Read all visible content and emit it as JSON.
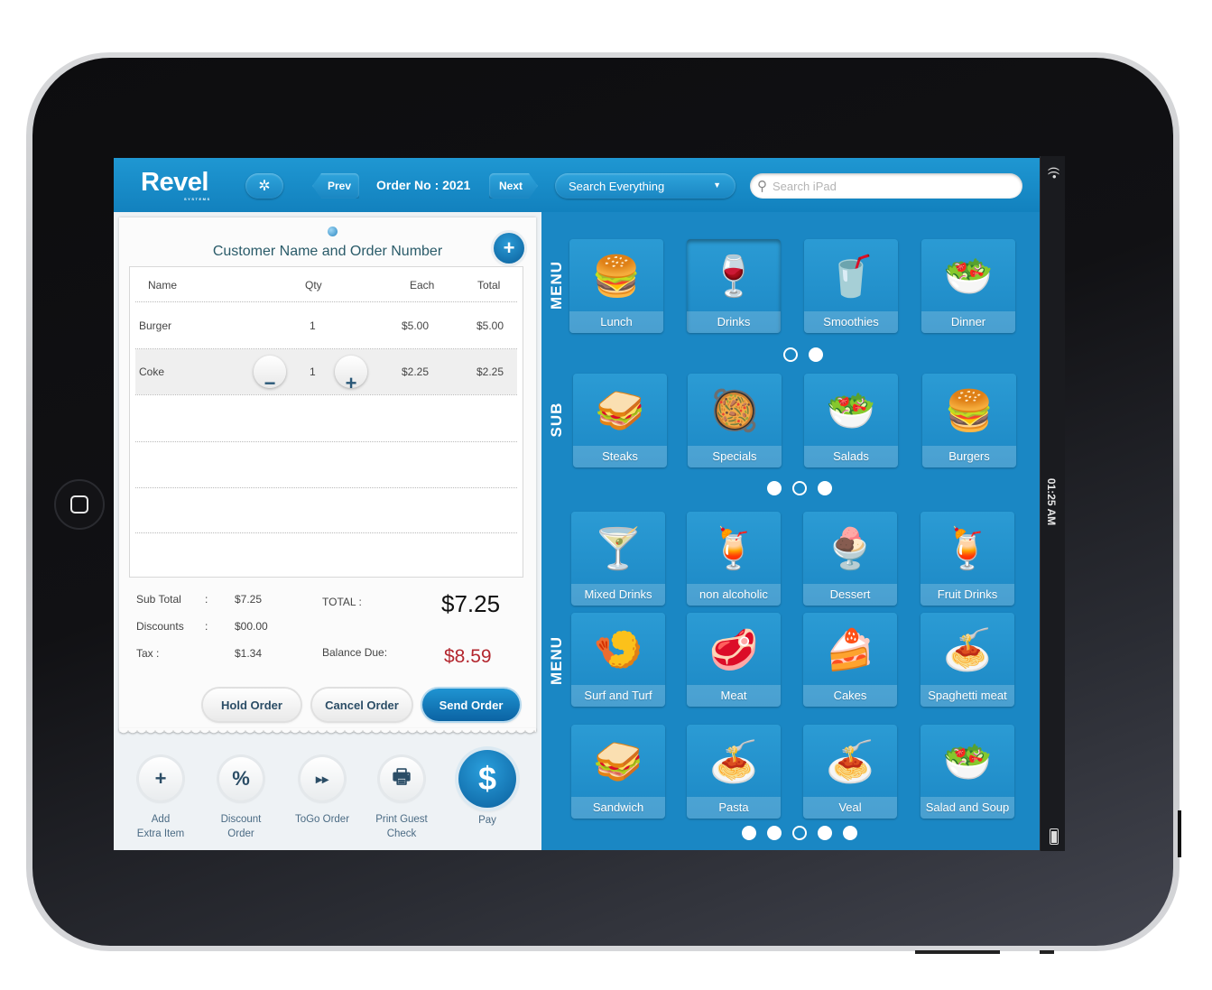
{
  "header": {
    "logo": "Revel",
    "logo_sub": "SYSTEMS",
    "settings_icon": "gear-icon",
    "prev_label": "Prev",
    "order_number": "Order No : 2021",
    "next_label": "Next",
    "search_scope": "Search Everything",
    "search_placeholder": "Search iPad",
    "search_value": ""
  },
  "status_bar": {
    "time": "01:25 AM",
    "wifi_icon": "wifi-icon",
    "battery_icon": "battery-icon"
  },
  "order": {
    "title": "Customer Name and Order Number",
    "columns": [
      "Name",
      "Qty",
      "Each",
      "Total"
    ],
    "items": [
      {
        "name": "Burger",
        "qty": "1",
        "each": "$5.00",
        "total": "$5.00",
        "selected": false
      },
      {
        "name": "Coke",
        "qty": "1",
        "each": "$2.25",
        "total": "$2.25",
        "selected": true
      }
    ],
    "totals": {
      "subtotal_label": "Sub Total",
      "subtotal_sep": ":",
      "subtotal": "$7.25",
      "discounts_label": "Discounts",
      "discounts_sep": ":",
      "discounts": "$00.00",
      "tax_label": "Tax :",
      "tax": "$1.34",
      "total_label": "TOTAL :",
      "total": "$7.25",
      "balance_label": "Balance Due:",
      "balance": "$8.59"
    },
    "buttons": {
      "hold": "Hold Order",
      "cancel": "Cancel Order",
      "send": "Send Order"
    }
  },
  "actions": [
    {
      "label_1": "Add",
      "label_2": "Extra Item",
      "icon": "+"
    },
    {
      "label_1": "Discount",
      "label_2": "Order",
      "icon": "%"
    },
    {
      "label_1": "ToGo Order",
      "label_2": "",
      "icon": "⏩"
    },
    {
      "label_1": "Print Guest",
      "label_2": "Check",
      "icon": "🖶"
    },
    {
      "label_1": "Pay",
      "label_2": "",
      "icon": "$"
    }
  ],
  "menu": {
    "section_labels": [
      "MENU",
      "SUB",
      "MENU"
    ],
    "categories": [
      {
        "label": "Lunch",
        "icon": "🍔"
      },
      {
        "label": "Drinks",
        "icon": "🍷"
      },
      {
        "label": "Smoothies",
        "icon": "🥤"
      },
      {
        "label": "Dinner",
        "icon": "🥗"
      }
    ],
    "categories_pager": {
      "pages": 2,
      "active": 0
    },
    "subcategories": [
      {
        "label": "Steaks",
        "icon": "🥪"
      },
      {
        "label": "Specials",
        "icon": "🥘"
      },
      {
        "label": "Salads",
        "icon": "🥗"
      },
      {
        "label": "Burgers",
        "icon": "🍔"
      }
    ],
    "subcategories_pager": {
      "pages": 3,
      "active": 1
    },
    "items": [
      {
        "label": "Mixed Drinks",
        "icon": "🍸"
      },
      {
        "label": "non alcoholic",
        "icon": "🍹"
      },
      {
        "label": "Dessert",
        "icon": "🍨"
      },
      {
        "label": "Fruit Drinks",
        "icon": "🍹"
      },
      {
        "label": "Surf and Turf",
        "icon": "🍤"
      },
      {
        "label": "Meat",
        "icon": "🥩"
      },
      {
        "label": "Cakes",
        "icon": "🍰"
      },
      {
        "label": "Spaghetti meat",
        "icon": "🍝"
      },
      {
        "label": "Sandwich",
        "icon": "🥪"
      },
      {
        "label": "Pasta",
        "icon": "🍝"
      },
      {
        "label": "Veal",
        "icon": "🍝"
      },
      {
        "label": "Salad and Soup",
        "icon": "🥗"
      }
    ],
    "items_pager": {
      "pages": 5,
      "active": 2
    }
  }
}
